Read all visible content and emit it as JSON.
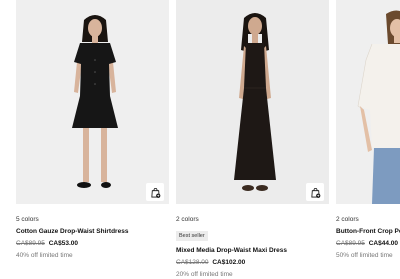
{
  "products": [
    {
      "colors": "5 colors",
      "name": "Cotton Gauze Drop-Waist Shirtdress",
      "old_price": "CA$89.95",
      "new_price": "CA$53.00",
      "promo": "40% off limited time",
      "dress_color": "#161616",
      "icon": "add-to-bag-icon"
    },
    {
      "colors": "2 colors",
      "badge": "Best seller",
      "name": "Mixed Media Drop-Waist Maxi Dress",
      "old_price": "CA$128.00",
      "new_price": "CA$102.00",
      "promo": "20% off limited time",
      "dress_color": "#1e1815",
      "icon": "add-to-bag-icon"
    },
    {
      "colors": "2 colors",
      "name": "Button-Front Crop Pep",
      "old_price": "CA$89.95",
      "new_price": "CA$44.00",
      "promo": "50% off limited time",
      "dress_color": "#f4f1ec",
      "icon": "add-to-bag-icon"
    }
  ]
}
